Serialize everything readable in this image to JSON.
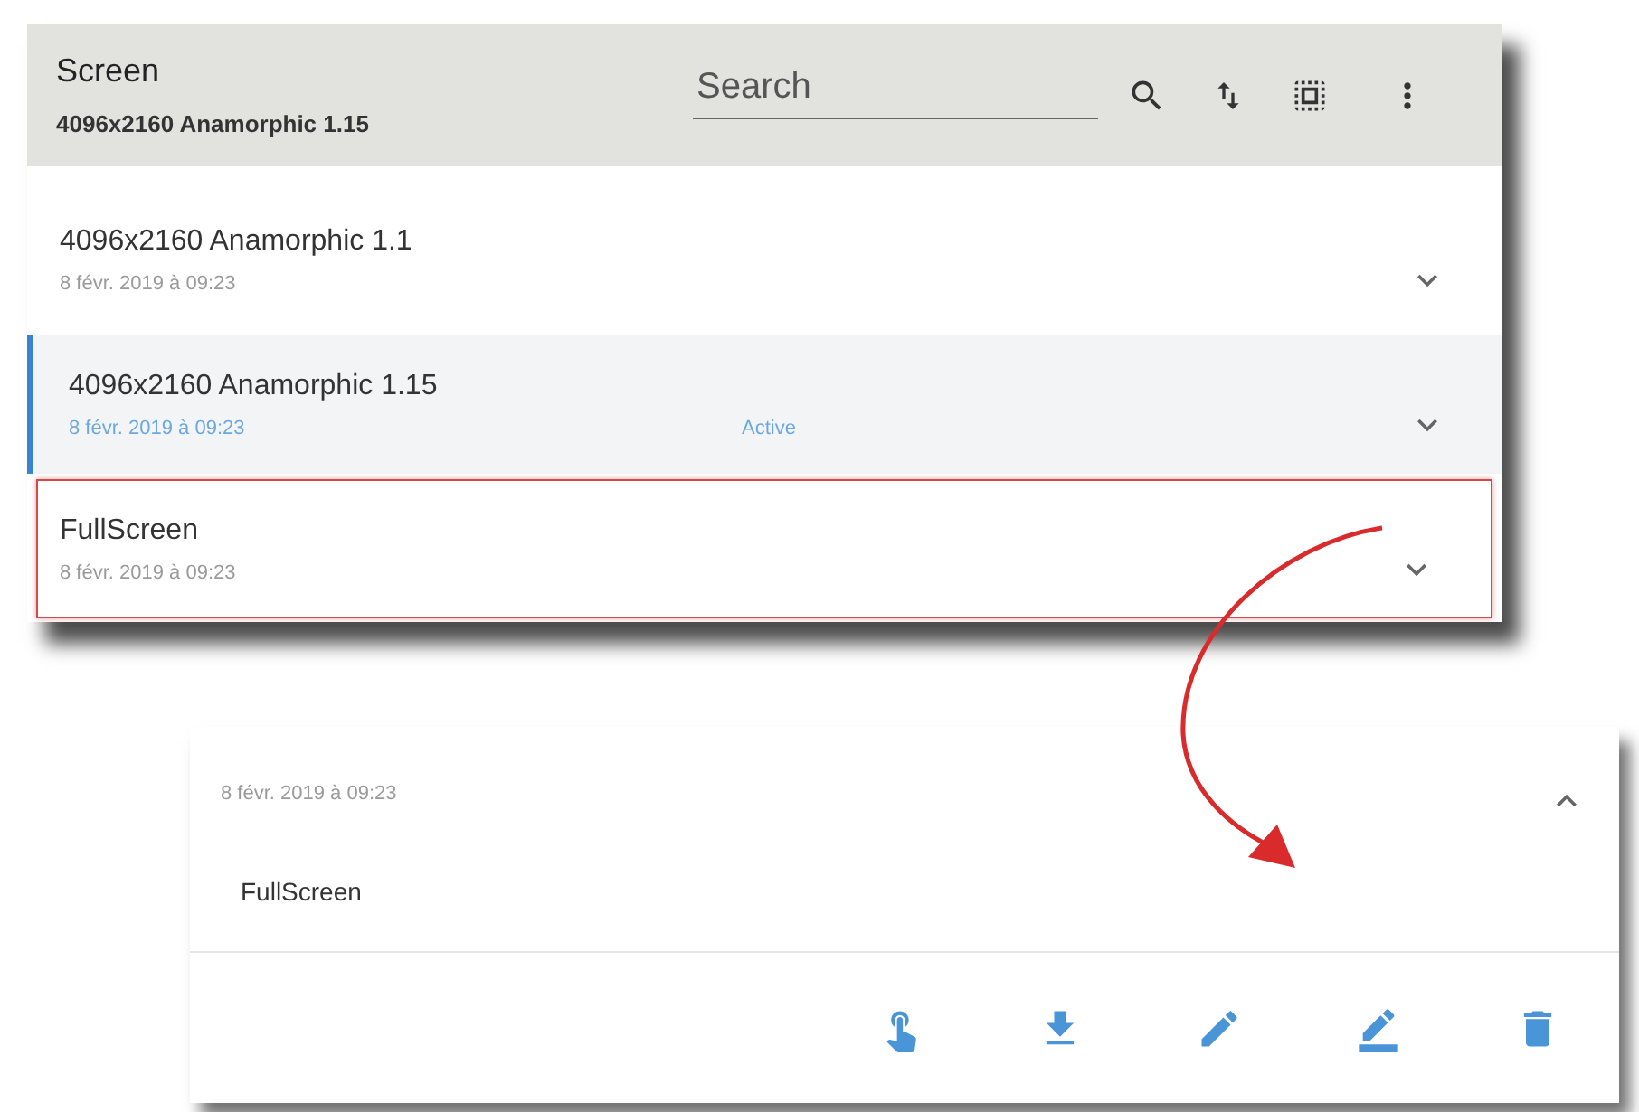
{
  "panel": {
    "title": "Screen",
    "subtitle": "4096x2160 Anamorphic 1.15",
    "search": {
      "placeholder": "Search"
    },
    "items": [
      {
        "name": "4096x2160 Anamorphic 1.1",
        "date": "8 févr. 2019 à 09:23",
        "selected": false,
        "highlighted": false,
        "expanded": false
      },
      {
        "name": "4096x2160 Anamorphic 1.15",
        "date": "8 févr. 2019 à 09:23",
        "status": "Active",
        "selected": true,
        "highlighted": false,
        "expanded": false
      },
      {
        "name": "FullScreen",
        "date": "8 févr. 2019 à 09:23",
        "selected": false,
        "highlighted": true,
        "expanded": false
      }
    ]
  },
  "detail": {
    "date": "8 févr. 2019 à 09:23",
    "name": "FullScreen",
    "expanded": true,
    "actions": [
      {
        "kind": "touch"
      },
      {
        "kind": "download"
      },
      {
        "kind": "edit"
      },
      {
        "kind": "edit_underline"
      },
      {
        "kind": "delete"
      }
    ]
  }
}
